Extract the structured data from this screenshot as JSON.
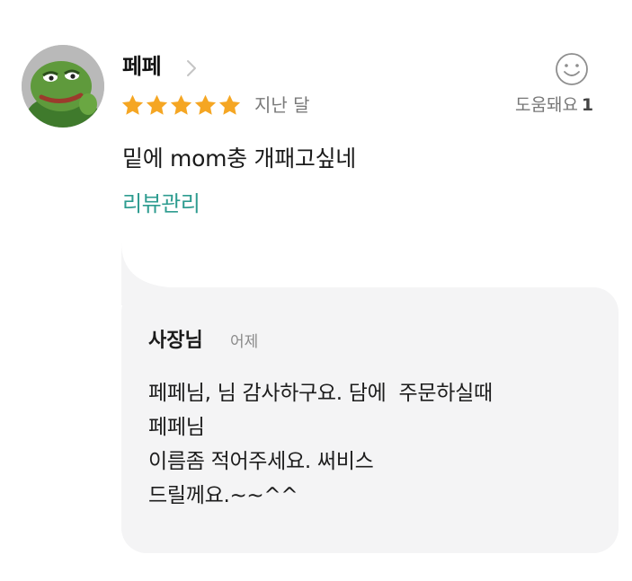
{
  "review": {
    "username": "페페",
    "rating": 5,
    "rating_max": 5,
    "date": "지난 달",
    "helpful_label": "도움돼요",
    "helpful_count": "1",
    "text": "밑에 mom충 개패고싶네",
    "manage_link": "리뷰관리"
  },
  "reply": {
    "author": "사장님",
    "date": "어제",
    "lines": [
      "페페님, 님 감사하구요. 담에  주문하실때",
      "페페님",
      "이름좀 적어주세요. 써비스",
      "드릴께요.~~^^"
    ]
  },
  "icons": {
    "avatar": "frog-avatar",
    "chevron": "chevron-right-icon",
    "star": "star-icon",
    "helpful": "smiley-icon"
  },
  "colors": {
    "star": "#f5a623",
    "link": "#2e9c90",
    "reply_background": "#f4f4f5"
  }
}
